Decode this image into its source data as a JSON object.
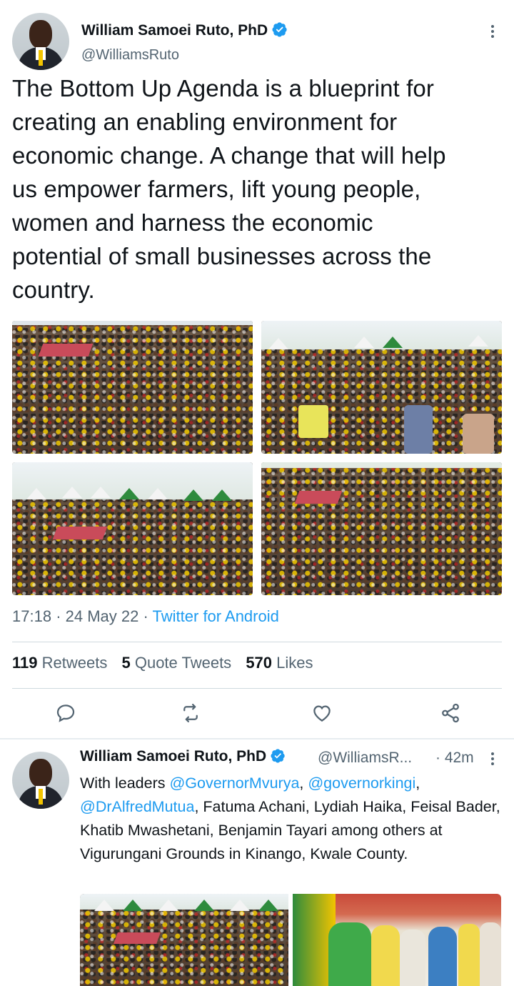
{
  "main_tweet": {
    "author_name": "William Samoei Ruto, PhD",
    "handle": "@WilliamsRuto",
    "text": "The Bottom Up Agenda is a blueprint for\ncreating an enabling environment for\neconomic change. A change that will help\nus empower farmers, lift young people,\nwomen and harness the economic\npotential of small businesses across the\ncountry.",
    "time": "17:18",
    "date": "24 May 22",
    "source": "Twitter for Android",
    "stats": {
      "retweets_count": "119",
      "retweets_label": "Retweets",
      "quotes_count": "5",
      "quotes_label": "Quote Tweets",
      "likes_count": "570",
      "likes_label": "Likes"
    }
  },
  "reply_tweet": {
    "author_name": "William Samoei Ruto, PhD",
    "handle": "@WilliamsR...",
    "time": "· 42m",
    "text_prefix": "With leaders ",
    "mention_1": "@GovernorMvurya",
    "sep_1": ", ",
    "mention_2": "@governorkingi",
    "sep_2": ",",
    "mention_3": "@DrAlfredMutua",
    "text_suffix": ", Fatuma Achani, Lydiah Haika, Feisal Bader, Khatib Mwashetani, Benjamin Tayari among others at Vigurungani Grounds in Kinango, Kwale County."
  },
  "meta_separator": "·",
  "icons": [
    "verified-badge-icon",
    "more-options-icon",
    "reply-icon",
    "retweet-icon",
    "like-icon",
    "share-icon"
  ],
  "colors": {
    "accent": "#1d9bf0",
    "text": "#0f1419",
    "muted": "#536471",
    "divider": "#cfd9de"
  }
}
